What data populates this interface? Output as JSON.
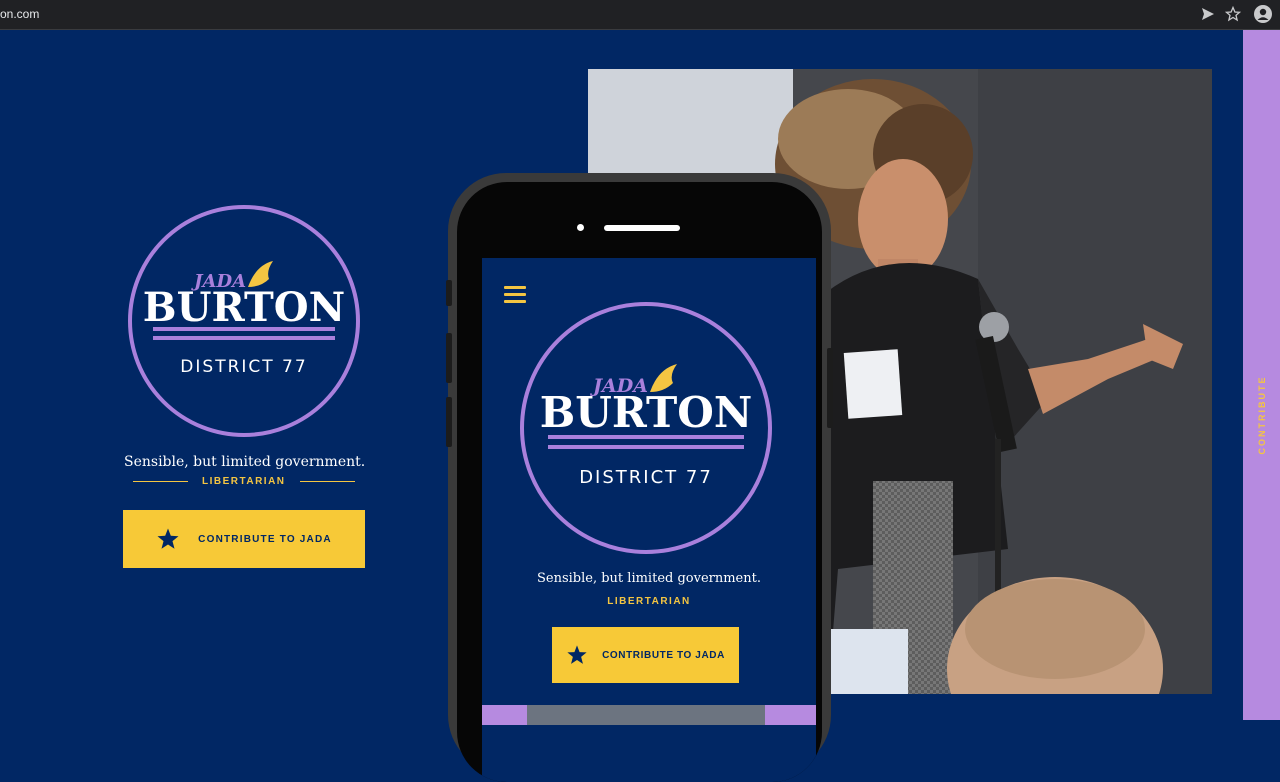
{
  "browser": {
    "url": "on.com"
  },
  "brand": {
    "first_name": "JADA",
    "last_name": "BURTON",
    "district": "DISTRICT 77",
    "tagline": "Sensible, but limited government.",
    "party": "LIBERTARIAN"
  },
  "cta": {
    "label": "CONTRIBUTE TO JADA"
  },
  "side_tab": {
    "label": "CONTRIBUTE"
  },
  "colors": {
    "navy": "#012764",
    "purple": "#b68ae0",
    "yellow": "#f7c937"
  }
}
